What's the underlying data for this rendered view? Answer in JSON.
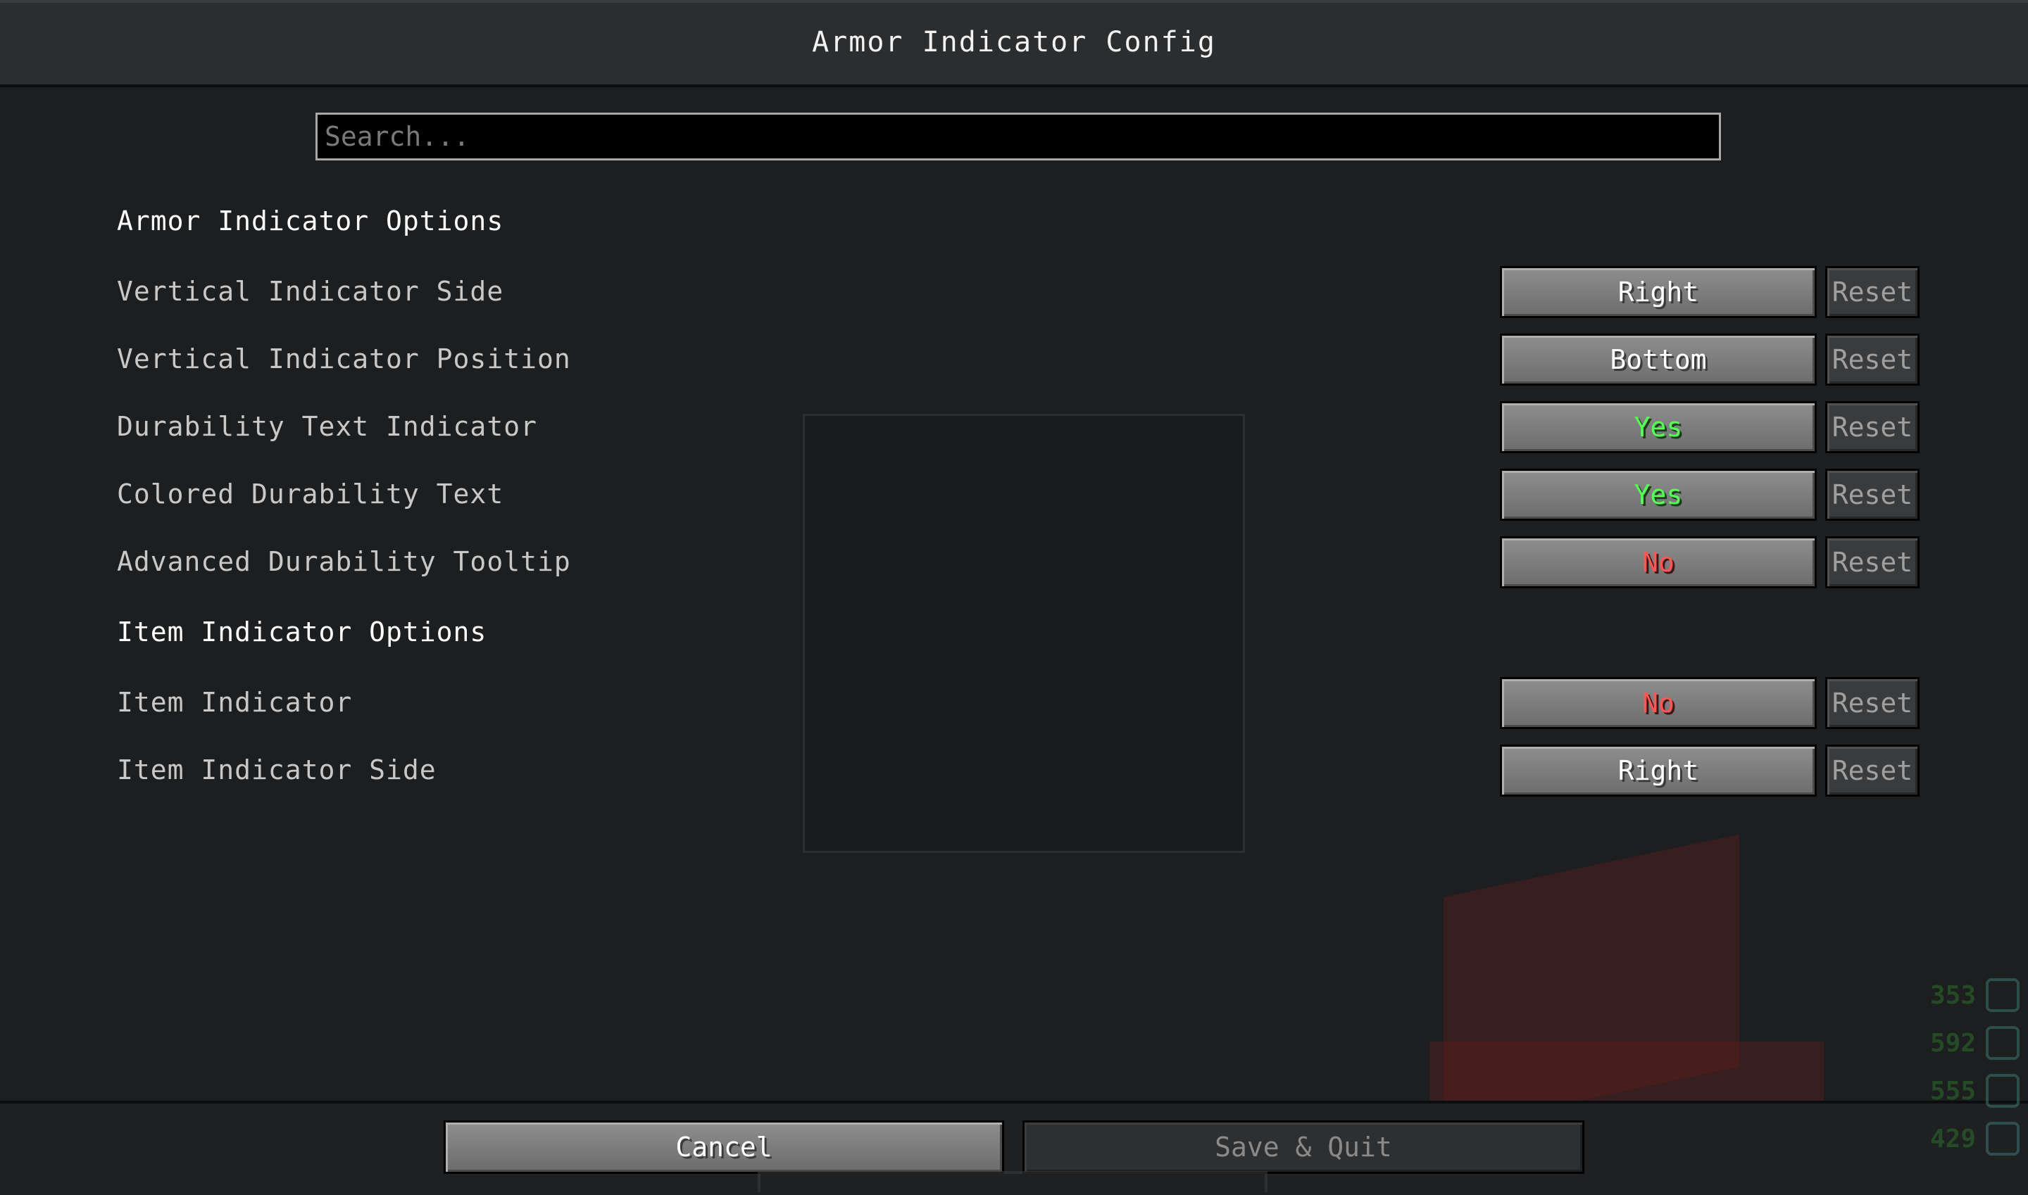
{
  "window": {
    "title": "Armor Indicator Config"
  },
  "search": {
    "placeholder": "Search..."
  },
  "sections": [
    {
      "title": "Armor Indicator Options",
      "rows": [
        {
          "label": "Vertical Indicator Side",
          "value": "Right",
          "value_color": "#ffffff",
          "reset_label": "Reset"
        },
        {
          "label": "Vertical Indicator Position",
          "value": "Bottom",
          "value_color": "#ffffff",
          "reset_label": "Reset"
        },
        {
          "label": "Durability Text Indicator",
          "value": "Yes",
          "value_color": "#55ff55",
          "reset_label": "Reset"
        },
        {
          "label": "Colored Durability Text",
          "value": "Yes",
          "value_color": "#55ff55",
          "reset_label": "Reset"
        },
        {
          "label": "Advanced Durability Tooltip",
          "value": "No",
          "value_color": "#ff5555",
          "reset_label": "Reset"
        }
      ]
    },
    {
      "title": "Item Indicator Options",
      "rows": [
        {
          "label": "Item Indicator",
          "value": "No",
          "value_color": "#ff5555",
          "reset_label": "Reset"
        },
        {
          "label": "Item Indicator Side",
          "value": "Right",
          "value_color": "#ffffff",
          "reset_label": "Reset"
        }
      ]
    }
  ],
  "footer": {
    "cancel_label": "Cancel",
    "save_label": "Save & Quit"
  },
  "hud": {
    "values": [
      "353",
      "592",
      "555",
      "429"
    ]
  },
  "colors": {
    "background": "#1c1e1f",
    "header": "#2b2d2e",
    "yes": "#55ff55",
    "no": "#ff5555"
  }
}
